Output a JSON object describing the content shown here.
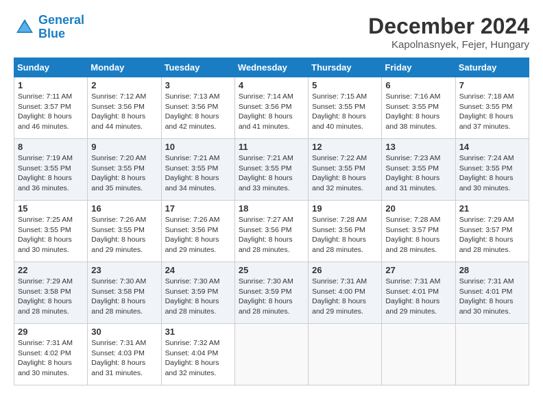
{
  "header": {
    "logo_line1": "General",
    "logo_line2": "Blue",
    "month_title": "December 2024",
    "location": "Kapolnasnyek, Fejer, Hungary"
  },
  "days_of_week": [
    "Sunday",
    "Monday",
    "Tuesday",
    "Wednesday",
    "Thursday",
    "Friday",
    "Saturday"
  ],
  "weeks": [
    [
      {
        "day": "1",
        "sunrise": "7:11 AM",
        "sunset": "3:57 PM",
        "daylight": "8 hours and 46 minutes."
      },
      {
        "day": "2",
        "sunrise": "7:12 AM",
        "sunset": "3:56 PM",
        "daylight": "8 hours and 44 minutes."
      },
      {
        "day": "3",
        "sunrise": "7:13 AM",
        "sunset": "3:56 PM",
        "daylight": "8 hours and 42 minutes."
      },
      {
        "day": "4",
        "sunrise": "7:14 AM",
        "sunset": "3:56 PM",
        "daylight": "8 hours and 41 minutes."
      },
      {
        "day": "5",
        "sunrise": "7:15 AM",
        "sunset": "3:55 PM",
        "daylight": "8 hours and 40 minutes."
      },
      {
        "day": "6",
        "sunrise": "7:16 AM",
        "sunset": "3:55 PM",
        "daylight": "8 hours and 38 minutes."
      },
      {
        "day": "7",
        "sunrise": "7:18 AM",
        "sunset": "3:55 PM",
        "daylight": "8 hours and 37 minutes."
      }
    ],
    [
      {
        "day": "8",
        "sunrise": "7:19 AM",
        "sunset": "3:55 PM",
        "daylight": "8 hours and 36 minutes."
      },
      {
        "day": "9",
        "sunrise": "7:20 AM",
        "sunset": "3:55 PM",
        "daylight": "8 hours and 35 minutes."
      },
      {
        "day": "10",
        "sunrise": "7:21 AM",
        "sunset": "3:55 PM",
        "daylight": "8 hours and 34 minutes."
      },
      {
        "day": "11",
        "sunrise": "7:21 AM",
        "sunset": "3:55 PM",
        "daylight": "8 hours and 33 minutes."
      },
      {
        "day": "12",
        "sunrise": "7:22 AM",
        "sunset": "3:55 PM",
        "daylight": "8 hours and 32 minutes."
      },
      {
        "day": "13",
        "sunrise": "7:23 AM",
        "sunset": "3:55 PM",
        "daylight": "8 hours and 31 minutes."
      },
      {
        "day": "14",
        "sunrise": "7:24 AM",
        "sunset": "3:55 PM",
        "daylight": "8 hours and 30 minutes."
      }
    ],
    [
      {
        "day": "15",
        "sunrise": "7:25 AM",
        "sunset": "3:55 PM",
        "daylight": "8 hours and 30 minutes."
      },
      {
        "day": "16",
        "sunrise": "7:26 AM",
        "sunset": "3:55 PM",
        "daylight": "8 hours and 29 minutes."
      },
      {
        "day": "17",
        "sunrise": "7:26 AM",
        "sunset": "3:56 PM",
        "daylight": "8 hours and 29 minutes."
      },
      {
        "day": "18",
        "sunrise": "7:27 AM",
        "sunset": "3:56 PM",
        "daylight": "8 hours and 28 minutes."
      },
      {
        "day": "19",
        "sunrise": "7:28 AM",
        "sunset": "3:56 PM",
        "daylight": "8 hours and 28 minutes."
      },
      {
        "day": "20",
        "sunrise": "7:28 AM",
        "sunset": "3:57 PM",
        "daylight": "8 hours and 28 minutes."
      },
      {
        "day": "21",
        "sunrise": "7:29 AM",
        "sunset": "3:57 PM",
        "daylight": "8 hours and 28 minutes."
      }
    ],
    [
      {
        "day": "22",
        "sunrise": "7:29 AM",
        "sunset": "3:58 PM",
        "daylight": "8 hours and 28 minutes."
      },
      {
        "day": "23",
        "sunrise": "7:30 AM",
        "sunset": "3:58 PM",
        "daylight": "8 hours and 28 minutes."
      },
      {
        "day": "24",
        "sunrise": "7:30 AM",
        "sunset": "3:59 PM",
        "daylight": "8 hours and 28 minutes."
      },
      {
        "day": "25",
        "sunrise": "7:30 AM",
        "sunset": "3:59 PM",
        "daylight": "8 hours and 28 minutes."
      },
      {
        "day": "26",
        "sunrise": "7:31 AM",
        "sunset": "4:00 PM",
        "daylight": "8 hours and 29 minutes."
      },
      {
        "day": "27",
        "sunrise": "7:31 AM",
        "sunset": "4:01 PM",
        "daylight": "8 hours and 29 minutes."
      },
      {
        "day": "28",
        "sunrise": "7:31 AM",
        "sunset": "4:01 PM",
        "daylight": "8 hours and 30 minutes."
      }
    ],
    [
      {
        "day": "29",
        "sunrise": "7:31 AM",
        "sunset": "4:02 PM",
        "daylight": "8 hours and 30 minutes."
      },
      {
        "day": "30",
        "sunrise": "7:31 AM",
        "sunset": "4:03 PM",
        "daylight": "8 hours and 31 minutes."
      },
      {
        "day": "31",
        "sunrise": "7:32 AM",
        "sunset": "4:04 PM",
        "daylight": "8 hours and 32 minutes."
      },
      null,
      null,
      null,
      null
    ]
  ]
}
